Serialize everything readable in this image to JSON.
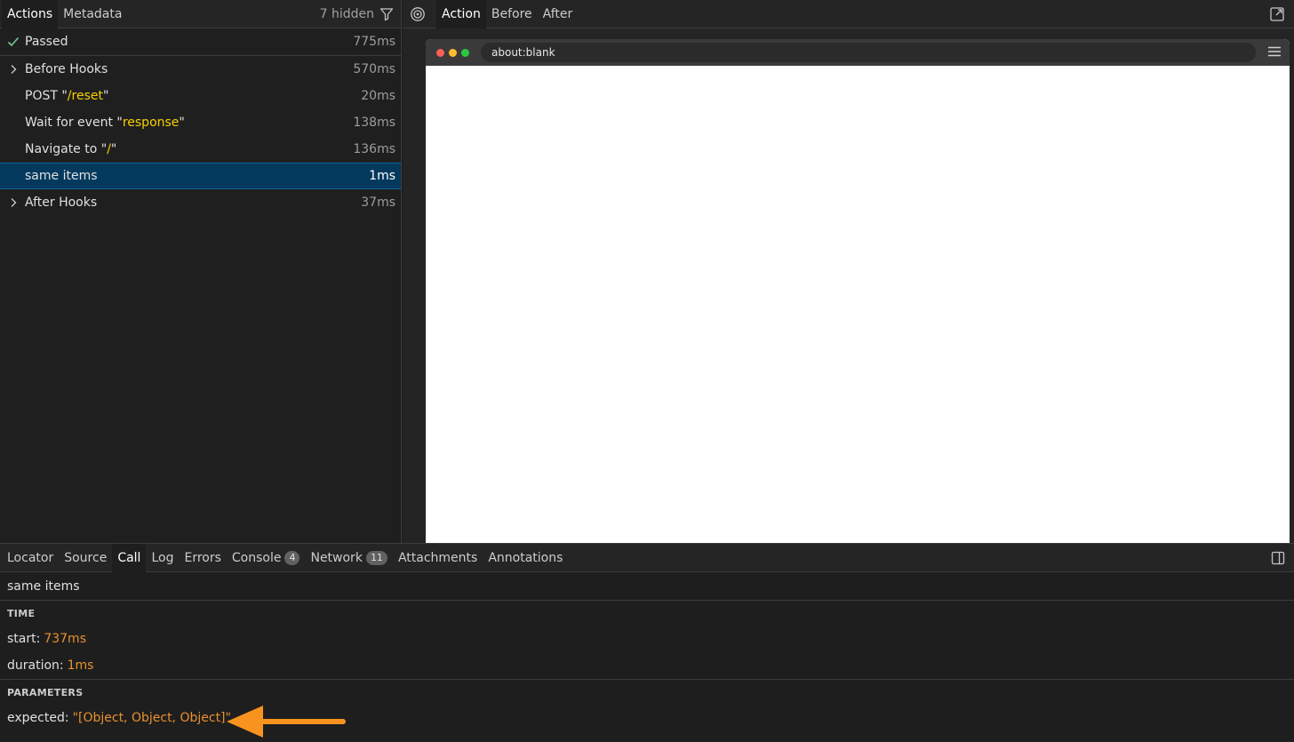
{
  "left": {
    "tabs": [
      {
        "label": "Actions"
      },
      {
        "label": "Metadata"
      }
    ],
    "hidden_label": "7 hidden",
    "status": {
      "label": "Passed",
      "duration": "775ms"
    },
    "actions": [
      {
        "prefix": "Before Hooks",
        "highlight": "",
        "suffix": "",
        "duration": "570ms"
      },
      {
        "prefix": "POST \"",
        "highlight": "/reset",
        "suffix": "\"",
        "duration": "20ms"
      },
      {
        "prefix": "Wait for event \"",
        "highlight": "response",
        "suffix": "\"",
        "duration": "138ms"
      },
      {
        "prefix": "Navigate to \"",
        "highlight": "/",
        "suffix": "\"",
        "duration": "136ms"
      },
      {
        "prefix": "same items",
        "highlight": "",
        "suffix": "",
        "duration": "1ms"
      },
      {
        "prefix": "After Hooks",
        "highlight": "",
        "suffix": "",
        "duration": "37ms"
      }
    ]
  },
  "right": {
    "tabs": [
      {
        "label": "Action"
      },
      {
        "label": "Before"
      },
      {
        "label": "After"
      }
    ],
    "url": "about:blank"
  },
  "bottom": {
    "tabs": [
      {
        "label": "Locator"
      },
      {
        "label": "Source"
      },
      {
        "label": "Call"
      },
      {
        "label": "Log"
      },
      {
        "label": "Errors"
      },
      {
        "label": "Console",
        "count": "4"
      },
      {
        "label": "Network",
        "count": "11"
      },
      {
        "label": "Attachments"
      },
      {
        "label": "Annotations"
      }
    ],
    "call_title": "same items",
    "time_header": "TIME",
    "start_label": "start:",
    "start_value": "737ms",
    "duration_label": "duration:",
    "duration_value": "1ms",
    "params_header": "PARAMETERS",
    "expected_label": "expected:",
    "expected_value": "\"[Object, Object, Object]\""
  },
  "colors": {
    "accent_selected": "#04395e",
    "string_yellow": "#f5d100",
    "value_orange": "#e8912d",
    "arrow_orange": "#f7931e",
    "pass_green": "#73c991"
  },
  "icons": [
    "check-icon",
    "chevron-right-icon",
    "filter-icon",
    "target-icon",
    "popout-icon",
    "hamburger-menu-icon",
    "sidebar-toggle-icon",
    "arrow-left-icon"
  ]
}
